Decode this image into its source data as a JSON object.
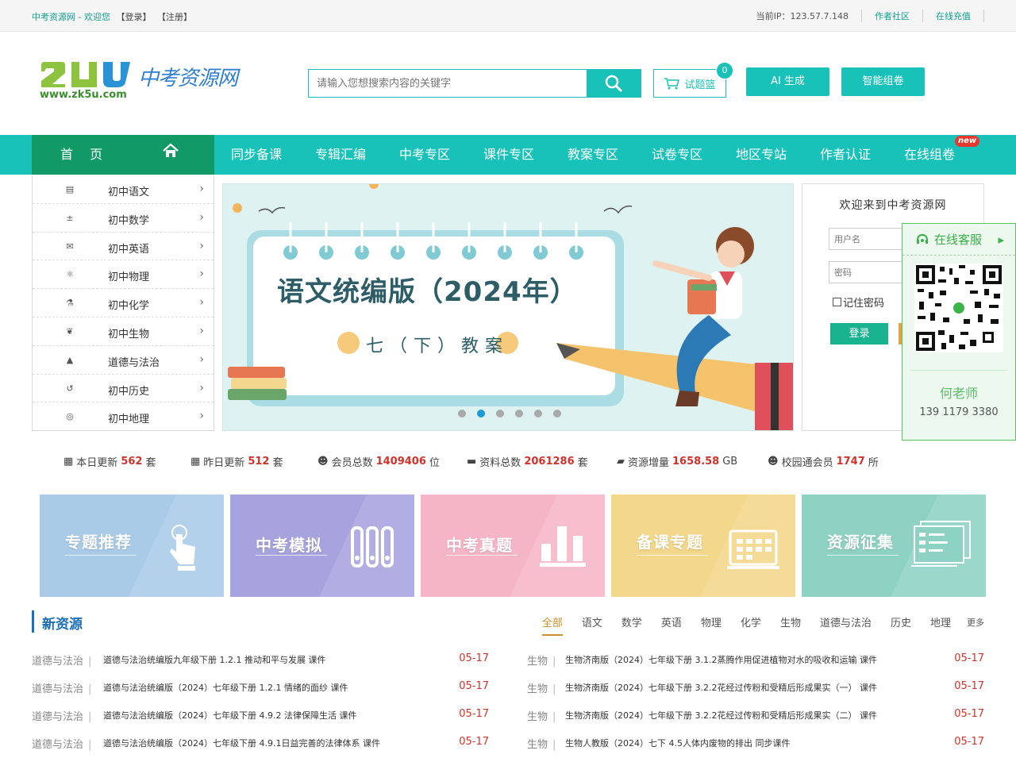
{
  "topbar": {
    "welcome": "中考资源网 - 欢迎您",
    "login_link": "【登录】",
    "register_link": "【注册】",
    "ip_text": "当前IP：123.57.7.148",
    "links": [
      "作者社区",
      "在线充值"
    ]
  },
  "header": {
    "logo_cn": "中考资源网",
    "logo_url": "www.zk5u.com",
    "search_placeholder": "请输入您想搜索内容的关键字",
    "cart_label": "试题篮",
    "cart_count": "0",
    "ai_button": "AI 生成",
    "compose_button": "智能组卷"
  },
  "nav": {
    "home": "首 页",
    "items": [
      "同步备课",
      "专辑汇编",
      "中考专区",
      "课件专区",
      "教案专区",
      "试卷专区",
      "地区专站",
      "作者认证",
      "在线组卷"
    ],
    "new_tag": "new"
  },
  "sidebar": {
    "items": [
      {
        "label": "初中语文",
        "icon": "book-icon"
      },
      {
        "label": "初中数学",
        "icon": "math-icon"
      },
      {
        "label": "初中英语",
        "icon": "chat-icon"
      },
      {
        "label": "初中物理",
        "icon": "atom-icon"
      },
      {
        "label": "初中化学",
        "icon": "flask-icon"
      },
      {
        "label": "初中生物",
        "icon": "leaf-icon"
      },
      {
        "label": "道德与法治",
        "icon": "cap-icon"
      },
      {
        "label": "初中历史",
        "icon": "history-icon"
      },
      {
        "label": "初中地理",
        "icon": "globe-icon"
      }
    ]
  },
  "banner": {
    "title": "语文统编版（2024年）",
    "subtitle": "七（下）教案",
    "dots": 6,
    "active_dot": 1
  },
  "login": {
    "title": "欢迎来到中考资源网",
    "username_placeholder": "用户名",
    "password_placeholder": "密码",
    "remember": "记住密码",
    "login_button": "登录"
  },
  "service": {
    "title": "在线客服",
    "name": "何老师",
    "phone": "139 1179 3380"
  },
  "stats": [
    {
      "label": "本日更新",
      "value": "562",
      "unit": "套",
      "icon": "calendar-icon"
    },
    {
      "label": "昨日更新",
      "value": "512",
      "unit": "套",
      "icon": "calendar-icon"
    },
    {
      "label": "会员总数",
      "value": "1409406",
      "unit": "位",
      "icon": "users-icon"
    },
    {
      "label": "资料总数",
      "value": "2061286",
      "unit": "套",
      "icon": "drive-icon"
    },
    {
      "label": "资源增量",
      "value": "1658.58",
      "unit": "GB",
      "icon": "folder-icon"
    },
    {
      "label": "校园通会员",
      "value": "1747",
      "unit": "所",
      "icon": "users-icon"
    }
  ],
  "tiles": [
    {
      "label": "专题推荐",
      "color": "#a9cbe8",
      "icon": "pointer-icon"
    },
    {
      "label": "中考模拟",
      "color": "#a6a3de",
      "icon": "binders-icon"
    },
    {
      "label": "中考真题",
      "color": "#f6b5c6",
      "icon": "bar-chart-icon"
    },
    {
      "label": "备课专题",
      "color": "#f3d78a",
      "icon": "calendar-board-icon"
    },
    {
      "label": "资源征集",
      "color": "#8ed2c3",
      "icon": "form-icon"
    }
  ],
  "new_resources": {
    "title": "新资源",
    "tabs": [
      "全部",
      "语文",
      "数学",
      "英语",
      "物理",
      "化学",
      "生物",
      "道德与法治",
      "历史",
      "地理"
    ],
    "more": "更多",
    "left": [
      {
        "subject": "道德与法治",
        "title": "道德与法治统编版九年级下册 1.2.1 推动和平与发展 课件",
        "date": "05-17"
      },
      {
        "subject": "道德与法治",
        "title": "道德与法治统编版（2024）七年级下册 1.2.1 情绪的面纱 课件",
        "date": "05-17"
      },
      {
        "subject": "道德与法治",
        "title": "道德与法治统编版（2024）七年级下册 4.9.2 法律保障生活 课件",
        "date": "05-17"
      },
      {
        "subject": "道德与法治",
        "title": "道德与法治统编版（2024）七年级下册 4.9.1日益完善的法律体系 课件",
        "date": "05-17"
      }
    ],
    "right": [
      {
        "subject": "生物",
        "title": "生物济南版（2024）七年级下册 3.1.2蒸腾作用促进植物对水的吸收和运输 课件",
        "date": "05-17"
      },
      {
        "subject": "生物",
        "title": "生物济南版（2024）七年级下册 3.2.2花经过传粉和受精后形成果实（一） 课件",
        "date": "05-17"
      },
      {
        "subject": "生物",
        "title": "生物济南版（2024）七年级下册 3.2.2花经过传粉和受精后形成果实（二） 课件",
        "date": "05-17"
      },
      {
        "subject": "生物",
        "title": "生物人教版（2024）七下 4.5人体内废物的排出 同步课件",
        "date": "05-17"
      }
    ]
  }
}
